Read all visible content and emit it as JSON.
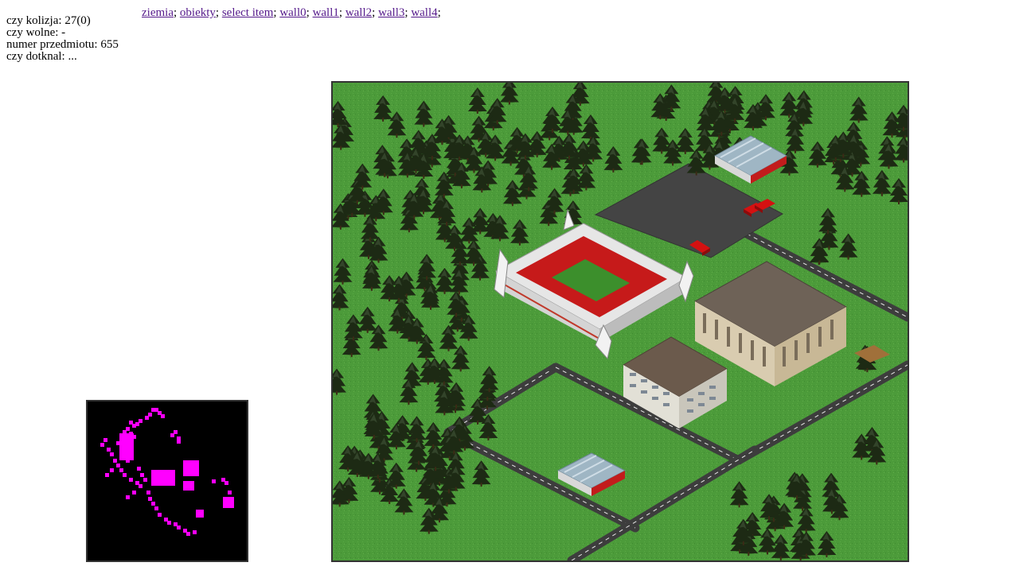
{
  "debug": {
    "collision_label": "czy kolizja:",
    "collision_value": "27(0)",
    "free_label": "czy wolne:",
    "free_value": "-",
    "item_number_label": "numer przedmiotu:",
    "item_number_value": "655",
    "touched_label": "czy dotknal:",
    "touched_value": "..."
  },
  "nav": {
    "links": [
      "ziemia",
      "obiekty",
      "select item",
      "wall0",
      "wall1",
      "wall2",
      "wall3",
      "wall4"
    ],
    "separator": ";"
  },
  "colors": {
    "grass": "#4c9b3a",
    "tree": "#1d2a14",
    "road": "#3d3d3d",
    "road_marking": "#e8e8e8",
    "minimap_bg": "#000000",
    "minimap_obstacle": "#ff00ff",
    "truck": "#d41111"
  }
}
